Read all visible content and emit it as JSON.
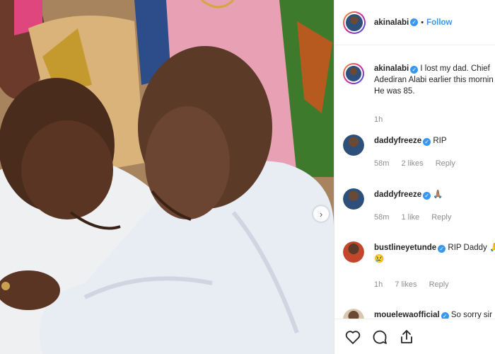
{
  "post": {
    "username": "akinalabi",
    "follow_label": "Follow",
    "caption": [
      "I lost my dad. Chief",
      "Adediran Alabi earlier this mornin",
      "He was 85."
    ],
    "caption_age": "1h"
  },
  "comments": [
    {
      "username": "daddyfreeze",
      "text": "RIP",
      "age": "58m",
      "likes": "2 likes",
      "reply": "Reply"
    },
    {
      "username": "daddyfreeze",
      "text": "🙏🏽",
      "age": "58m",
      "likes": "1 like",
      "reply": "Reply"
    },
    {
      "username": "bustlineyetunde",
      "text": "RIP Daddy 🙏",
      "text_line2": "😢",
      "age": "1h",
      "likes": "7 likes",
      "reply": "Reply"
    },
    {
      "username": "mouelewaofficial",
      "text": "So sorry sir"
    }
  ],
  "icons": [
    "heart-icon",
    "comment-icon",
    "share-icon",
    "carousel-next-icon",
    "verified-icon"
  ],
  "colors": {
    "accent": "#3897f0",
    "text": "#262626",
    "muted": "#8e8e8e"
  }
}
